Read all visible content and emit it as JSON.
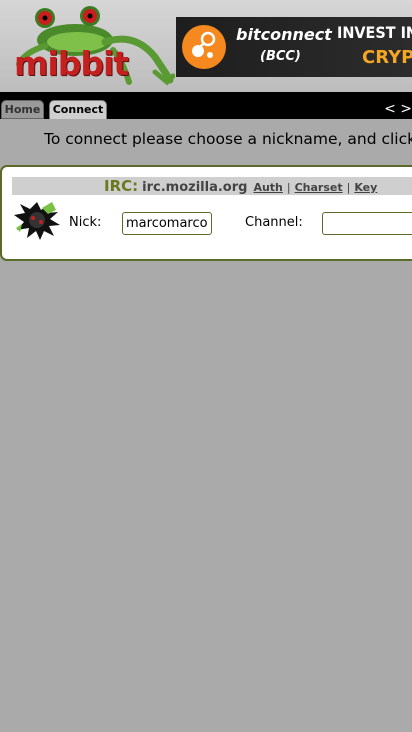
{
  "header": {
    "logo_text": "mibbit"
  },
  "ad": {
    "brand": "bitconnect",
    "brand_sub": "(BCC)",
    "headline": "INVEST INN",
    "headline2": "CRYPT",
    "brand_color": "#f5891f"
  },
  "tabs": [
    {
      "label": "Home"
    },
    {
      "label": "Connect"
    }
  ],
  "nav": {
    "arrows": "< >"
  },
  "intro": "To connect please choose a nickname, and click c",
  "server": {
    "irc_label": "IRC:",
    "name": "irc.mozilla.org",
    "links": [
      "Auth",
      "Charset",
      "Key"
    ],
    "separator": "|"
  },
  "form": {
    "nick_label": "Nick:",
    "nick_value": "marcomarco",
    "channel_label": "Channel:",
    "channel_value": ""
  },
  "colors": {
    "accent": "#5a6a2a",
    "irc_label": "#6a7a20",
    "background": "#aaaaaa"
  }
}
